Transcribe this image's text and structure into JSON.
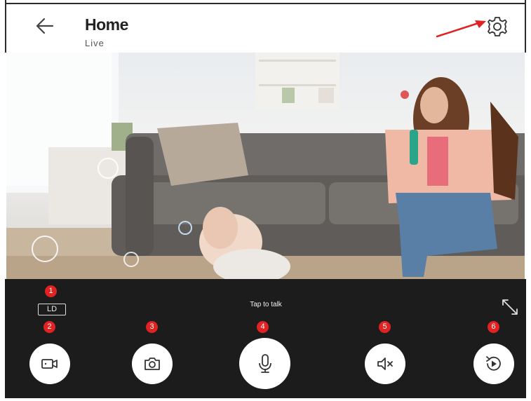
{
  "header": {
    "title": "Home",
    "subtitle": "Live",
    "back_icon": "arrow-left-icon",
    "settings_icon": "gear-icon"
  },
  "annotation_color": "#e02222",
  "controls": {
    "background": "#1c1c1c",
    "quality_label": "LD",
    "talk_label": "Tap to talk",
    "badges": [
      "1",
      "2",
      "3",
      "4",
      "5",
      "6"
    ],
    "buttons": [
      {
        "name": "record",
        "icon": "video-camera-icon"
      },
      {
        "name": "snapshot",
        "icon": "camera-icon"
      },
      {
        "name": "talk",
        "icon": "microphone-icon"
      },
      {
        "name": "mute",
        "icon": "speaker-muted-icon"
      },
      {
        "name": "playback",
        "icon": "replay-icon"
      }
    ],
    "fullscreen_icon": "expand-icon"
  }
}
